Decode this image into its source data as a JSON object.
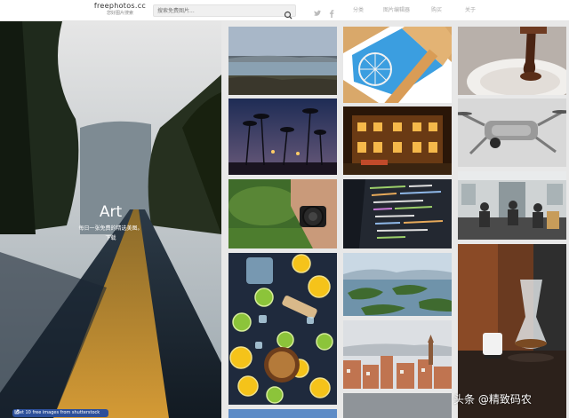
{
  "header": {
    "site_title": "freephotos.cc",
    "site_subtitle": "您好图片搜索",
    "search_placeholder": "搜索免费图片...",
    "nav": [
      "分类",
      "图片编辑器",
      "购买",
      "关于"
    ]
  },
  "hero": {
    "title": "Art",
    "subtitle": "每日一张免费的精选美图。",
    "link": "下载",
    "promo": "Get 10 free images from shutterstock"
  },
  "watermark": "头条 @精致码农",
  "icons": {
    "search": "search-icon",
    "twitter": "twitter-icon",
    "facebook": "facebook-icon",
    "external": "external-link-icon"
  },
  "gallery": {
    "column_1": [
      "landscape-water-mountains",
      "palm-trees-night",
      "camera-in-hand",
      "citrus-fruit-flatlay"
    ],
    "column_2": [
      "ferris-wheel-frame",
      "lit-building-night",
      "code-on-screen",
      "lake-islands-aerial",
      "city-rooftops"
    ],
    "column_3": [
      "chocolate-sauce-pour",
      "drone",
      "subway-interior",
      "coffee-brewing"
    ]
  }
}
